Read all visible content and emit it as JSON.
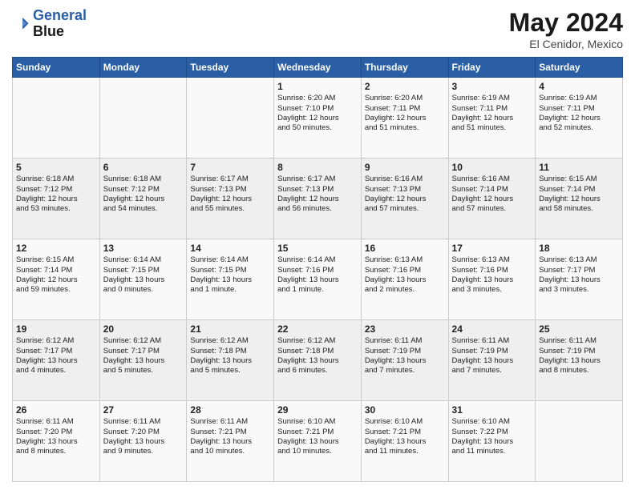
{
  "header": {
    "logo_line1": "General",
    "logo_line2": "Blue",
    "main_title": "May 2024",
    "subtitle": "El Cenidor, Mexico"
  },
  "days_of_week": [
    "Sunday",
    "Monday",
    "Tuesday",
    "Wednesday",
    "Thursday",
    "Friday",
    "Saturday"
  ],
  "weeks": [
    [
      {
        "day": "",
        "info": ""
      },
      {
        "day": "",
        "info": ""
      },
      {
        "day": "",
        "info": ""
      },
      {
        "day": "1",
        "info": "Sunrise: 6:20 AM\nSunset: 7:10 PM\nDaylight: 12 hours\nand 50 minutes."
      },
      {
        "day": "2",
        "info": "Sunrise: 6:20 AM\nSunset: 7:11 PM\nDaylight: 12 hours\nand 51 minutes."
      },
      {
        "day": "3",
        "info": "Sunrise: 6:19 AM\nSunset: 7:11 PM\nDaylight: 12 hours\nand 51 minutes."
      },
      {
        "day": "4",
        "info": "Sunrise: 6:19 AM\nSunset: 7:11 PM\nDaylight: 12 hours\nand 52 minutes."
      }
    ],
    [
      {
        "day": "5",
        "info": "Sunrise: 6:18 AM\nSunset: 7:12 PM\nDaylight: 12 hours\nand 53 minutes."
      },
      {
        "day": "6",
        "info": "Sunrise: 6:18 AM\nSunset: 7:12 PM\nDaylight: 12 hours\nand 54 minutes."
      },
      {
        "day": "7",
        "info": "Sunrise: 6:17 AM\nSunset: 7:13 PM\nDaylight: 12 hours\nand 55 minutes."
      },
      {
        "day": "8",
        "info": "Sunrise: 6:17 AM\nSunset: 7:13 PM\nDaylight: 12 hours\nand 56 minutes."
      },
      {
        "day": "9",
        "info": "Sunrise: 6:16 AM\nSunset: 7:13 PM\nDaylight: 12 hours\nand 57 minutes."
      },
      {
        "day": "10",
        "info": "Sunrise: 6:16 AM\nSunset: 7:14 PM\nDaylight: 12 hours\nand 57 minutes."
      },
      {
        "day": "11",
        "info": "Sunrise: 6:15 AM\nSunset: 7:14 PM\nDaylight: 12 hours\nand 58 minutes."
      }
    ],
    [
      {
        "day": "12",
        "info": "Sunrise: 6:15 AM\nSunset: 7:14 PM\nDaylight: 12 hours\nand 59 minutes."
      },
      {
        "day": "13",
        "info": "Sunrise: 6:14 AM\nSunset: 7:15 PM\nDaylight: 13 hours\nand 0 minutes."
      },
      {
        "day": "14",
        "info": "Sunrise: 6:14 AM\nSunset: 7:15 PM\nDaylight: 13 hours\nand 1 minute."
      },
      {
        "day": "15",
        "info": "Sunrise: 6:14 AM\nSunset: 7:16 PM\nDaylight: 13 hours\nand 1 minute."
      },
      {
        "day": "16",
        "info": "Sunrise: 6:13 AM\nSunset: 7:16 PM\nDaylight: 13 hours\nand 2 minutes."
      },
      {
        "day": "17",
        "info": "Sunrise: 6:13 AM\nSunset: 7:16 PM\nDaylight: 13 hours\nand 3 minutes."
      },
      {
        "day": "18",
        "info": "Sunrise: 6:13 AM\nSunset: 7:17 PM\nDaylight: 13 hours\nand 3 minutes."
      }
    ],
    [
      {
        "day": "19",
        "info": "Sunrise: 6:12 AM\nSunset: 7:17 PM\nDaylight: 13 hours\nand 4 minutes."
      },
      {
        "day": "20",
        "info": "Sunrise: 6:12 AM\nSunset: 7:17 PM\nDaylight: 13 hours\nand 5 minutes."
      },
      {
        "day": "21",
        "info": "Sunrise: 6:12 AM\nSunset: 7:18 PM\nDaylight: 13 hours\nand 5 minutes."
      },
      {
        "day": "22",
        "info": "Sunrise: 6:12 AM\nSunset: 7:18 PM\nDaylight: 13 hours\nand 6 minutes."
      },
      {
        "day": "23",
        "info": "Sunrise: 6:11 AM\nSunset: 7:19 PM\nDaylight: 13 hours\nand 7 minutes."
      },
      {
        "day": "24",
        "info": "Sunrise: 6:11 AM\nSunset: 7:19 PM\nDaylight: 13 hours\nand 7 minutes."
      },
      {
        "day": "25",
        "info": "Sunrise: 6:11 AM\nSunset: 7:19 PM\nDaylight: 13 hours\nand 8 minutes."
      }
    ],
    [
      {
        "day": "26",
        "info": "Sunrise: 6:11 AM\nSunset: 7:20 PM\nDaylight: 13 hours\nand 8 minutes."
      },
      {
        "day": "27",
        "info": "Sunrise: 6:11 AM\nSunset: 7:20 PM\nDaylight: 13 hours\nand 9 minutes."
      },
      {
        "day": "28",
        "info": "Sunrise: 6:11 AM\nSunset: 7:21 PM\nDaylight: 13 hours\nand 10 minutes."
      },
      {
        "day": "29",
        "info": "Sunrise: 6:10 AM\nSunset: 7:21 PM\nDaylight: 13 hours\nand 10 minutes."
      },
      {
        "day": "30",
        "info": "Sunrise: 6:10 AM\nSunset: 7:21 PM\nDaylight: 13 hours\nand 11 minutes."
      },
      {
        "day": "31",
        "info": "Sunrise: 6:10 AM\nSunset: 7:22 PM\nDaylight: 13 hours\nand 11 minutes."
      },
      {
        "day": "",
        "info": ""
      }
    ]
  ]
}
